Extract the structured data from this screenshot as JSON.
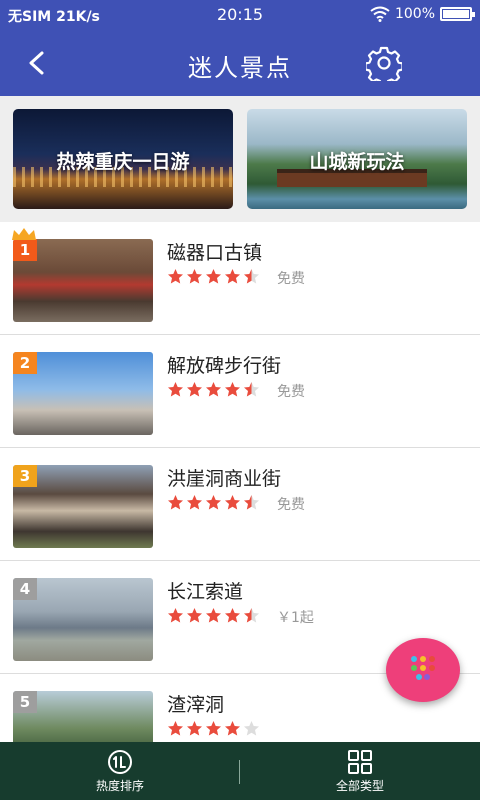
{
  "status_bar": {
    "carrier": "无SIM",
    "speed": "21K/s",
    "time": "20:15",
    "battery": "100%",
    "battery_level": 1.0
  },
  "app_bar": {
    "title": "迷人景点",
    "back_icon": "chevron-left-icon",
    "settings_icon": "gear-icon"
  },
  "banners": [
    {
      "label": "热辣重庆一日游"
    },
    {
      "label": "山城新玩法"
    }
  ],
  "attractions": [
    {
      "rank": "1",
      "rank_color": "#f25a1a",
      "name": "磁器口古镇",
      "rating": 4.5,
      "price": "免费"
    },
    {
      "rank": "2",
      "rank_color": "#f5851f",
      "name": "解放碑步行街",
      "rating": 4.5,
      "price": "免费"
    },
    {
      "rank": "3",
      "rank_color": "#f0a31c",
      "name": "洪崖洞商业街",
      "rating": 4.5,
      "price": "免费"
    },
    {
      "rank": "4",
      "rank_color": "#9e9e9e",
      "name": "长江索道",
      "rating": 4.5,
      "price": "￥1起"
    },
    {
      "rank": "5",
      "rank_color": "#9e9e9e",
      "name": "渣滓洞",
      "rating": 4,
      "price": ""
    }
  ],
  "colors": {
    "primary": "#3f51b5",
    "star": "#e94c3d",
    "star_empty": "#dddddd",
    "fab": "#ee3f7a",
    "bottom_bar": "#173c2e"
  },
  "fab": {
    "icon": "dots-menu-icon"
  },
  "bottom_nav": [
    {
      "label": "热度排序",
      "icon": "sort-hot-icon"
    },
    {
      "label": "全部类型",
      "icon": "grid-icon"
    }
  ]
}
